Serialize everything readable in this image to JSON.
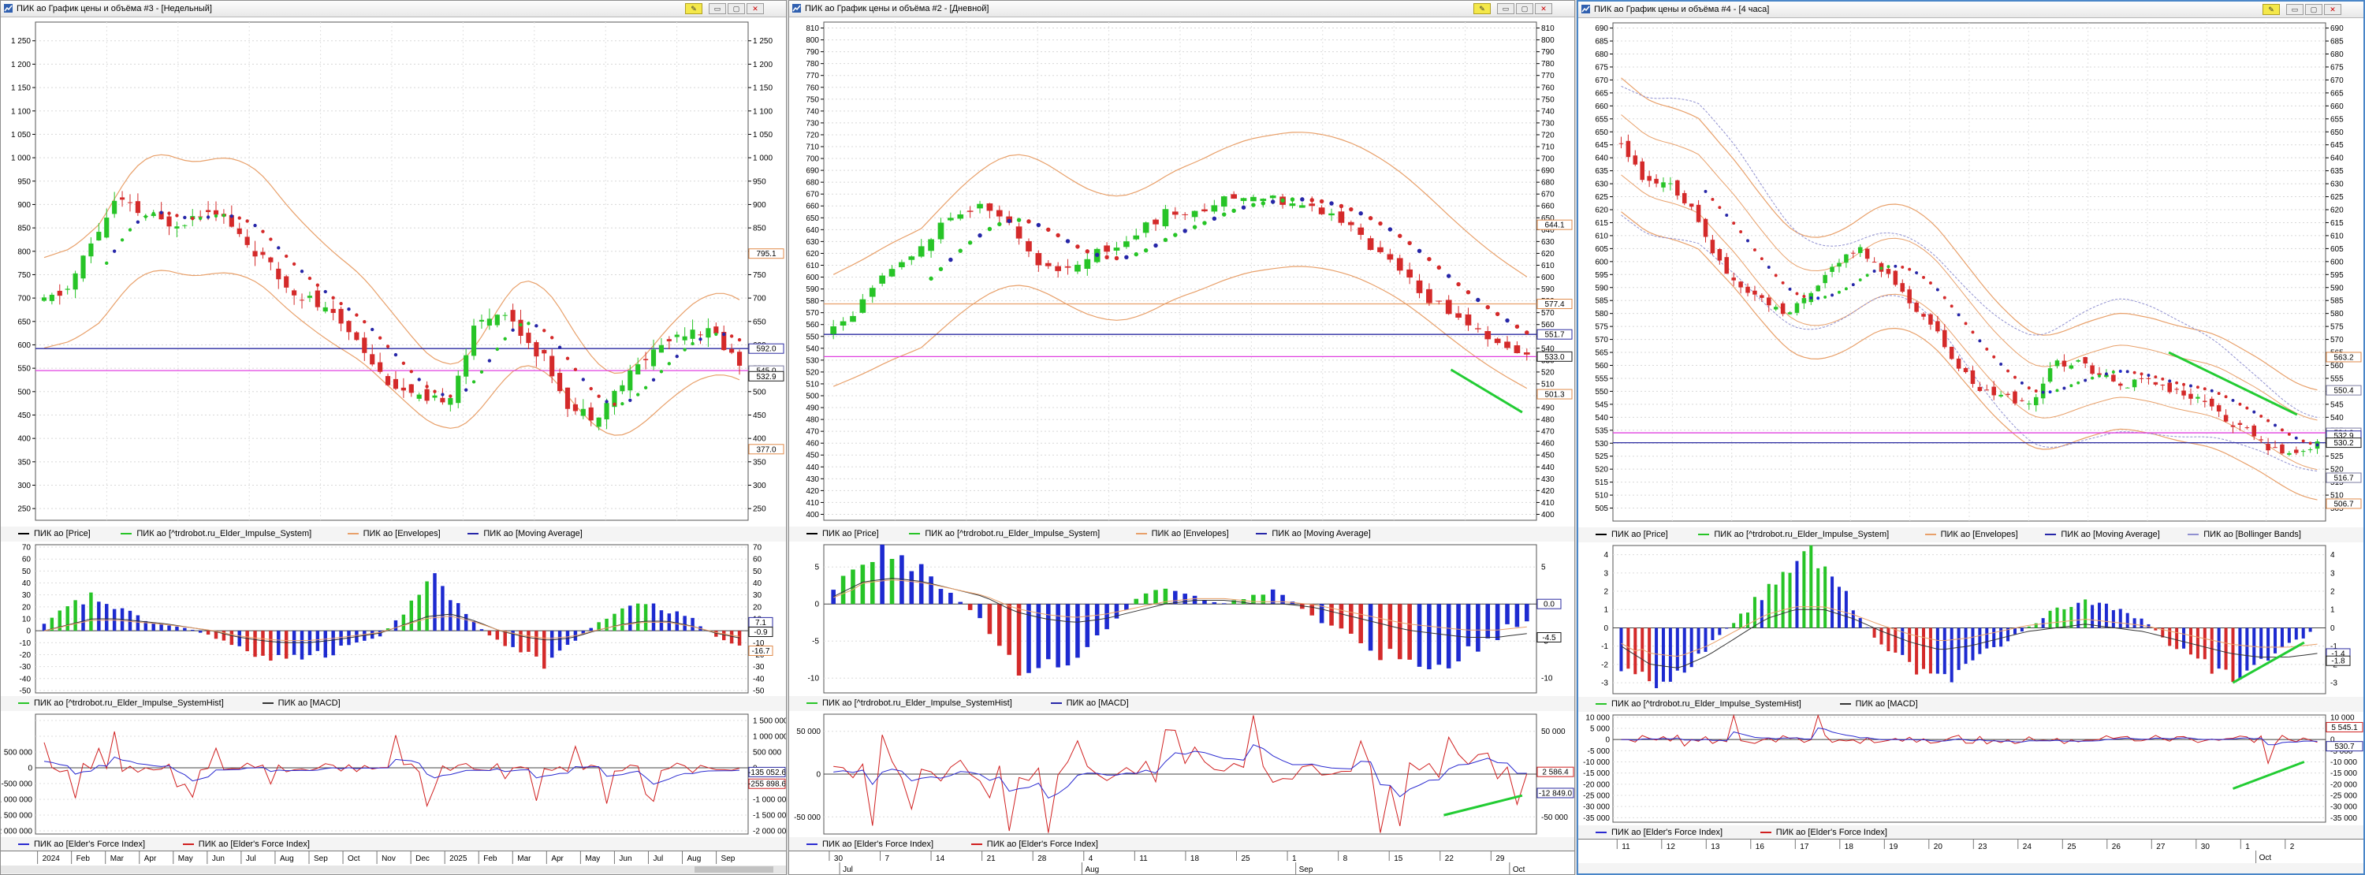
{
  "windows": [
    {
      "title": "ПИК ао График цены и объёма #3 - [Недельный]",
      "price_axis": [
        "1 250",
        "1 200",
        "1 150",
        "1 100",
        "1 050",
        "1 000",
        "950",
        "900",
        "850",
        "800",
        "750",
        "700",
        "650",
        "600",
        "550",
        "500",
        "450",
        "400",
        "350",
        "300",
        "250"
      ],
      "price_markers": [
        {
          "text": "795.1",
          "color": "#e08a4a"
        },
        {
          "text": "592.0",
          "color": "#2a2aa0"
        },
        {
          "text": "545.0",
          "color": "#7a7aa0"
        },
        {
          "text": "532.9",
          "color": "#1a1a1a"
        },
        {
          "text": "377.0",
          "color": "#e08a4a"
        }
      ],
      "price_legend": [
        "ПИК ао [Price]",
        "ПИК ао [^trdrobot.ru_Elder_Impulse_System]",
        "ПИК ао [Envelopes]",
        "ПИК ао [Moving Average]"
      ],
      "macd_axis": [
        "70",
        "60",
        "50",
        "40",
        "30",
        "20",
        "10",
        "0",
        "-10",
        "-20",
        "-30",
        "-40",
        "-50"
      ],
      "macd_markers": [
        {
          "text": "7.1",
          "color": "#2a2aa0"
        },
        {
          "text": "-0.9",
          "color": "#1a1a1a"
        },
        {
          "text": "-16.7",
          "color": "#e08a4a"
        }
      ],
      "macd_legend": [
        "ПИК ао [^trdrobot.ru_Elder_Impulse_SystemHist]",
        "ПИК ао [MACD]"
      ],
      "force_left_axis": [
        "500 000",
        "0",
        "-500 000",
        "-1 000 000",
        "-1 500 000",
        "-2 000 000"
      ],
      "force_right_axis": [
        "1 500 000",
        "1 000 000",
        "500 000",
        "0",
        "-500 000",
        "-1 000 000",
        "-1 500 000",
        "-2 000 000"
      ],
      "force_markers": [
        {
          "text": "-135 052.6",
          "color": "#2a2aa0"
        },
        {
          "text": "-255 898.6",
          "color": "#d02020"
        }
      ],
      "force_legend": [
        "ПИК ао [Elder's Force Index]",
        "ПИК ао [Elder's Force Index]"
      ],
      "time_labels": [
        "2024",
        "Feb",
        "Mar",
        "Apr",
        "May",
        "Jun",
        "Jul",
        "Aug",
        "Sep",
        "Oct",
        "Nov",
        "Dec",
        "2025",
        "Feb",
        "Mar",
        "Apr",
        "May",
        "Jun",
        "Jul",
        "Aug",
        "Sep"
      ]
    },
    {
      "title": "ПИК ао График цены и объёма #2 - [Дневной]",
      "price_axis": [
        "810",
        "800",
        "790",
        "780",
        "770",
        "760",
        "750",
        "740",
        "730",
        "720",
        "710",
        "700",
        "690",
        "680",
        "670",
        "660",
        "650",
        "640",
        "630",
        "620",
        "610",
        "600",
        "590",
        "580",
        "570",
        "560",
        "550",
        "540",
        "530",
        "520",
        "510",
        "500",
        "490",
        "480",
        "470",
        "460",
        "450",
        "440",
        "430",
        "420",
        "410",
        "400"
      ],
      "price_markers": [
        {
          "text": "644.1",
          "color": "#e08a4a"
        },
        {
          "text": "577.4",
          "color": "#e08a4a"
        },
        {
          "text": "551.7",
          "color": "#2a2aa0"
        },
        {
          "text": "533.0",
          "color": "#1a1a1a"
        },
        {
          "text": "501.3",
          "color": "#e08a4a"
        }
      ],
      "price_legend": [
        "ПИК ао [Price]",
        "ПИК ао [^trdrobot.ru_Elder_Impulse_System]",
        "ПИК ао [Envelopes]",
        "ПИК ао [Moving Average]"
      ],
      "macd_axis": [
        "5",
        "0",
        "-5",
        "-10"
      ],
      "macd_markers": [
        {
          "text": "0.0",
          "color": "#2a2aa0"
        },
        {
          "text": "-4.5",
          "color": "#1a1a1a"
        }
      ],
      "macd_legend": [
        "ПИК ао [^trdrobot.ru_Elder_Impulse_SystemHist]",
        "ПИК ао [MACD]"
      ],
      "force_left_axis": [
        "50 000",
        "0",
        "-50 000"
      ],
      "force_right_axis": [
        "50 000",
        "0",
        "-50 000"
      ],
      "force_markers": [
        {
          "text": "2 586.4",
          "color": "#d02020"
        },
        {
          "text": "-12 849.0",
          "color": "#2a2aa0"
        }
      ],
      "force_legend": [
        "ПИК ао [Elder's Force Index]",
        "ПИК ао [Elder's Force Index]"
      ],
      "time_labels": [
        "30",
        "7",
        "14",
        "21",
        "28",
        "4",
        "11",
        "18",
        "25",
        "1",
        "8",
        "15",
        "22",
        "29"
      ],
      "time_months": [
        "Jul",
        "Aug",
        "Sep",
        "Oct"
      ]
    },
    {
      "title": "ПИК ао График цены и объёма #4 - [4 часа]",
      "price_axis": [
        "690",
        "685",
        "680",
        "675",
        "670",
        "665",
        "660",
        "655",
        "650",
        "645",
        "640",
        "635",
        "630",
        "625",
        "620",
        "615",
        "610",
        "605",
        "600",
        "595",
        "590",
        "585",
        "580",
        "575",
        "570",
        "565",
        "560",
        "555",
        "550",
        "545",
        "540",
        "535",
        "530",
        "525",
        "520",
        "515",
        "510",
        "505"
      ],
      "price_markers": [
        {
          "text": "563.2",
          "color": "#e08a4a"
        },
        {
          "text": "550.4",
          "color": "#7a7aa0"
        },
        {
          "text": "534.0",
          "color": "#7a7aa0"
        },
        {
          "text": "532.9",
          "color": "#2a2aa0"
        },
        {
          "text": "530.2",
          "color": "#1a1a1a"
        },
        {
          "text": "516.7",
          "color": "#7a7aa0"
        },
        {
          "text": "506.7",
          "color": "#e08a4a"
        }
      ],
      "price_legend": [
        "ПИК ао [Price]",
        "ПИК ао [^trdrobot.ru_Elder_Impulse_System]",
        "ПИК ао [Envelopes]",
        "ПИК ао [Moving Average]",
        "ПИК ао [Bollinger Bands]"
      ],
      "macd_axis": [
        "4",
        "3",
        "2",
        "1",
        "0",
        "-1",
        "-2",
        "-3"
      ],
      "macd_markers": [
        {
          "text": "-1.4",
          "color": "#2a2aa0"
        },
        {
          "text": "-1.8",
          "color": "#1a1a1a"
        }
      ],
      "macd_legend": [
        "ПИК ао [^trdrobot.ru_Elder_Impulse_SystemHist]",
        "ПИК ао [MACD]"
      ],
      "force_left_axis": [
        "10 000",
        "5 000",
        "0",
        "-5 000",
        "-10 000",
        "-15 000",
        "-20 000",
        "-25 000",
        "-30 000",
        "-35 000"
      ],
      "force_right_axis": [
        "10 000",
        "5 000",
        "0",
        "-5 000",
        "-10 000",
        "-15 000",
        "-20 000",
        "-25 000",
        "-30 000",
        "-35 000"
      ],
      "force_markers": [
        {
          "text": "5 545.1",
          "color": "#d02020"
        },
        {
          "text": "530.7",
          "color": "#2a2aa0"
        }
      ],
      "force_legend": [
        "ПИК ао [Elder's Force Index]",
        "ПИК ао [Elder's Force Index]"
      ],
      "time_labels": [
        "11",
        "12",
        "13",
        "16",
        "17",
        "18",
        "19",
        "20",
        "23",
        "24",
        "25",
        "26",
        "27",
        "30",
        "1",
        "2"
      ],
      "time_months": [
        "Oct"
      ]
    }
  ],
  "colors": {
    "bull": "#27c427",
    "bear": "#d42a2a",
    "neutral": "#1d2ad0",
    "envelope": "#e8a06a",
    "ma": "#2626a8",
    "magenta": "#e040e0",
    "bollinger": "#9090d0",
    "force_red": "#d02020",
    "force_blue": "#2a2ad0",
    "trendline": "#22cc33"
  },
  "icons": {
    "pin": "pin-icon",
    "minimize": "minimize-icon",
    "restore": "restore-icon",
    "close": "close-icon"
  },
  "chart_data": [
    {
      "type": "candlestick",
      "title": "ПИК ао График цены и объёма #3 - [Недельный]",
      "ylim": [
        225,
        1290
      ],
      "x": [
        "2024",
        "Feb",
        "Mar",
        "Apr",
        "May",
        "Jun",
        "Jul",
        "Aug",
        "Sep",
        "Oct",
        "Nov",
        "Dec",
        "2025",
        "Feb",
        "Mar",
        "Apr",
        "May",
        "Jun",
        "Jul",
        "Aug",
        "Sep"
      ],
      "series": [
        {
          "name": "ПИК ао [Price]",
          "values": [
            690,
            760,
            900,
            880,
            860,
            870,
            820,
            720,
            640,
            600,
            520,
            500,
            520,
            680,
            660,
            560,
            470,
            490,
            560,
            640,
            560
          ]
        }
      ]
    },
    {
      "type": "candlestick",
      "title": "ПИК ао График цены и объёма #2 - [Дневной]",
      "ylim": [
        395,
        815
      ],
      "x": [
        "30",
        "7",
        "14",
        "21",
        "28",
        "4",
        "11",
        "18",
        "25",
        "1",
        "8",
        "15",
        "22",
        "29"
      ],
      "series": [
        {
          "name": "ПИК ао [Price]",
          "values": [
            560,
            600,
            650,
            640,
            610,
            630,
            650,
            660,
            670,
            660,
            620,
            580,
            545,
            530
          ]
        }
      ]
    },
    {
      "type": "candlestick",
      "title": "ПИК ао График цены и объёма #4 - [4 часа]",
      "ylim": [
        500,
        692
      ],
      "x": [
        "11",
        "12",
        "13",
        "16",
        "17",
        "18",
        "19",
        "20",
        "23",
        "24",
        "25",
        "26",
        "27",
        "30",
        "1",
        "2"
      ],
      "series": [
        {
          "name": "ПИК ао [Price]",
          "values": [
            635,
            625,
            600,
            585,
            600,
            595,
            580,
            565,
            548,
            560,
            555,
            552,
            548,
            535,
            525,
            530
          ]
        }
      ]
    }
  ]
}
